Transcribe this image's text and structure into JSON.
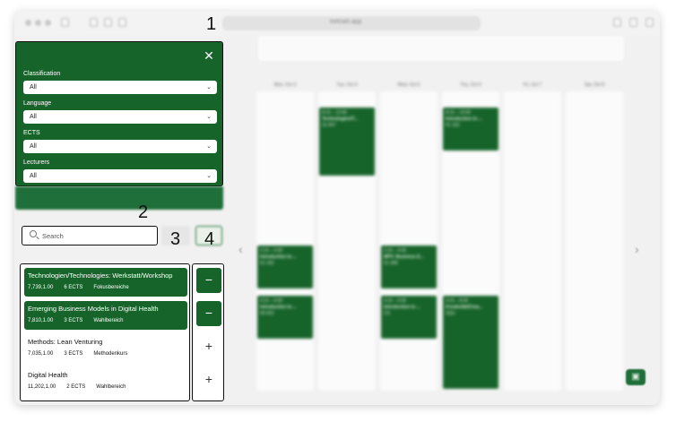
{
  "browser": {
    "url": "tretriatt.app"
  },
  "filters": {
    "close_glyph": "✕",
    "fields": [
      {
        "label": "Classification",
        "value": "All"
      },
      {
        "label": "Language",
        "value": "All"
      },
      {
        "label": "ECTS",
        "value": "All"
      },
      {
        "label": "Lecturers",
        "value": "All"
      }
    ]
  },
  "search": {
    "placeholder": "Search"
  },
  "courses": [
    {
      "title": "Technologien/Technologies: Werkstatt/Workshop",
      "code": "7,739,1.00",
      "ects": "6 ECTS",
      "category": "Fokusbereiche",
      "selected": true
    },
    {
      "title": "Emerging Business Models in Digital Health",
      "code": "7,810,1.00",
      "ects": "3 ECTS",
      "category": "Wahlbereich",
      "selected": true
    },
    {
      "title": "Methods: Lean Venturing",
      "code": "7,035,1.00",
      "ects": "3 ECTS",
      "category": "Methodenkurs",
      "selected": false
    },
    {
      "title": "Digital Health",
      "code": "11,202,1.00",
      "ects": "2 ECTS",
      "category": "Wahlbereich",
      "selected": false
    }
  ],
  "actions": {
    "remove_glyph": "−",
    "add_glyph": "+"
  },
  "calendar": {
    "days": [
      "Mon, Oct 3",
      "Tue, Oct 4",
      "Wed, Oct 5",
      "Thu, Oct 6",
      "Fri, Oct 7",
      "Sat, Oct 8"
    ],
    "events": [
      {
        "day": 0,
        "lines": [
          "2:15 – 4:00",
          "Introduction to ...",
          "01-162"
        ]
      },
      {
        "day": 0,
        "lines": [
          "4:15 – 6:00",
          "Introduction to ...",
          "09-022"
        ]
      },
      {
        "day": 1,
        "lines": [
          "8:15 – 12:00",
          "Technologien/T...",
          "22-007"
        ]
      },
      {
        "day": 2,
        "lines": [
          "2:15 – 4:00",
          "MPV: Business E...",
          "01-308"
        ]
      },
      {
        "day": 2,
        "lines": [
          "4:15 – 6:00",
          "Introduction to ...",
          "CS"
        ]
      },
      {
        "day": 3,
        "lines": [
          "8:15 – 10:00",
          "Introduction to ...",
          "01-162"
        ]
      },
      {
        "day": 3,
        "lines": [
          "4:15 – 8:00",
          "Kreativität/Crea...",
          "SQU"
        ]
      }
    ],
    "prev_glyph": "‹",
    "next_glyph": "›"
  },
  "callouts": [
    "1",
    "2",
    "3",
    "4"
  ],
  "colors": {
    "primary_green": "#17642b",
    "panel_border": "#111111"
  }
}
